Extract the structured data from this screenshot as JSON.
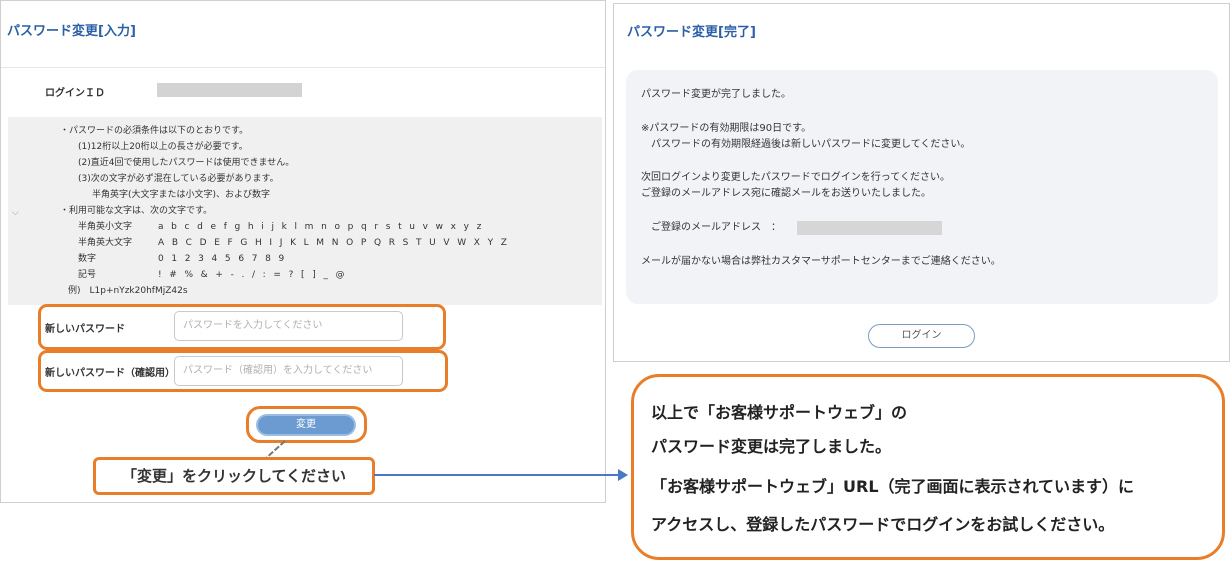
{
  "left": {
    "title": "パスワード変更[入力]",
    "login_id_label": "ログインＩＤ",
    "rules": [
      "・パスワードの必須条件は以下のとおりです。",
      "(1)12桁以上20桁以上の長さが必要です。",
      "(2)直近4回で使用したパスワードは使用できません。",
      "(3)次の文字が必ず混在している必要があります。",
      "半角英字(大文字または小文字)、および数字",
      "・利用可能な文字は、次の文字です。"
    ],
    "charsets": [
      {
        "label": "半角英小文字",
        "chars": "a b c d e f g h i j k l m n o p q r s t u v w x y z"
      },
      {
        "label": "半角英大文字",
        "chars": "A B C D E F G H I J K L M N O P Q R S T U V W X Y Z"
      },
      {
        "label": "数字",
        "chars": "0 1 2 3 4 5 6 7 8 9"
      },
      {
        "label": "記号",
        "chars": "! # % & + - . / : = ? [ ] _ @"
      }
    ],
    "example": "例)　L1p+nYzk20hfMjZ42s",
    "new_password_label": "新しいパスワード",
    "new_password_placeholder": "パスワードを入力してください",
    "confirm_password_label": "新しいパスワード（確認用）",
    "confirm_password_placeholder": "パスワード（確認用）を入力してください",
    "change_button": "変更",
    "click_hint": "「変更」をクリックしてください"
  },
  "right": {
    "title": "パスワード変更[完了]",
    "lines": [
      "パスワード変更が完了しました。",
      "※パスワードの有効期限は90日です。",
      "　パスワードの有効期限経過後は新しいパスワードに変更してください。",
      "次回ログインより変更したパスワードでログインを行ってください。",
      "ご登録のメールアドレス宛に確認メールをお送りいたしました。",
      "メールが届かない場合は弊社カスタマーサポートセンターまでご連絡ください。"
    ],
    "email_label": "ご登録のメールアドレス　：",
    "login_button": "ログイン"
  },
  "note": {
    "lines": [
      "以上で「お客様サポートウェブ」の",
      "パスワード変更は完了しました。",
      "「お客様サポートウェブ」URL（完了画面に表示されています）に",
      "アクセスし、登録したパスワードでログインをお試しください。"
    ]
  },
  "colors": {
    "accent_orange": "#e97e2a",
    "title_blue": "#2b5fa8",
    "button_blue": "#6b9bd1",
    "arrow_blue": "#4a78c2"
  }
}
